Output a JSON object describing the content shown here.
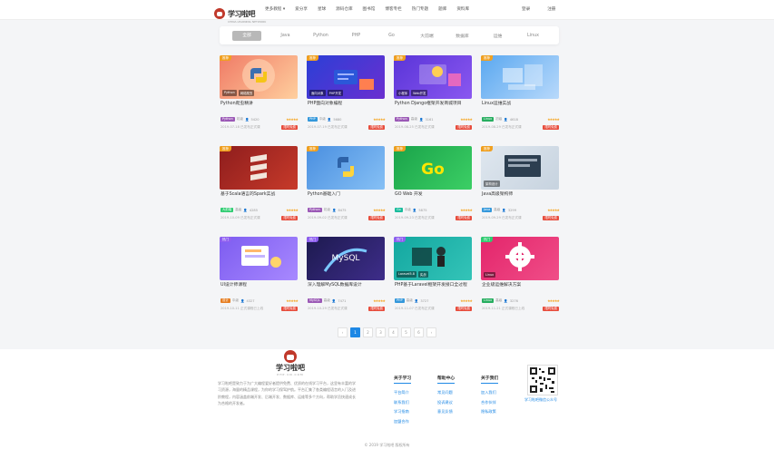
{
  "header": {
    "logo_text": "学习啦吧",
    "logo_sub": "CHINA LEARNING NETWORK",
    "nav": [
      "更多教程 ▾",
      "爱分享",
      "星球",
      "源码仓库",
      "图书馆",
      "博客专栏",
      "热门专题",
      "题库",
      "资料库"
    ],
    "auth": [
      "登录",
      "注册"
    ]
  },
  "filter": {
    "tabs": [
      "全部",
      "Java",
      "Python",
      "PHP",
      "Go",
      "大前端",
      "数据库",
      "运维",
      "Linux"
    ],
    "active_index": 0
  },
  "courses": [
    {
      "tag": "推荐",
      "tag_color": "orange",
      "badges": [
        "Python",
        "网络爬虫"
      ],
      "title": "Python爬虫精讲",
      "lang": "Python",
      "lang_color": "#9b59b6",
      "level": "初级",
      "views": "5420",
      "date": "2019-07-18 已发布正式课",
      "price": "限时免费",
      "bg": "#f07b66",
      "bg2": "#ffcf9e",
      "icon": "python"
    },
    {
      "tag": "推荐",
      "tag_color": "orange",
      "badges": [
        "面向对象",
        "PHP开发"
      ],
      "title": "PHP面向对象编程",
      "lang": "PHP",
      "lang_color": "#3498db",
      "level": "中级",
      "views": "5680",
      "date": "2019-07-19 已发布正式课",
      "price": "限时免费",
      "bg": "#2b3fd6",
      "bg2": "#6a2fd0",
      "icon": "php"
    },
    {
      "tag": "推荐",
      "tag_color": "orange",
      "badges": [
        "小程序",
        "Web开发"
      ],
      "title": "Python Django框架开发商城项目",
      "lang": "Python",
      "lang_color": "#9b59b6",
      "level": "高级",
      "views": "3161",
      "date": "2019-08-25 已发布正式课",
      "price": "限时免费",
      "bg": "#5a35d8",
      "bg2": "#8a57f0",
      "icon": "django"
    },
    {
      "tag": "推荐",
      "tag_color": "orange",
      "badges": [],
      "title": "Linux运维实战",
      "lang": "Linux",
      "lang_color": "#27ae60",
      "level": "初级",
      "views": "4618",
      "date": "2019-08-29 已发布正式课",
      "price": "限时免费",
      "bg": "#5aa8f0",
      "bg2": "#b8d9fb",
      "icon": "linux"
    },
    {
      "tag": "推荐",
      "tag_color": "orange",
      "badges": [],
      "title": "基于Scala语言的Spark实战",
      "lang": "大前端",
      "lang_color": "#2ecc71",
      "level": "高级",
      "views": "4285",
      "date": "2019-10-09 已发布正式课",
      "price": "限时免费",
      "bg": "#8e1d1d",
      "bg2": "#c73a2a",
      "icon": "scala"
    },
    {
      "tag": "推荐",
      "tag_color": "orange",
      "badges": [],
      "title": "Python基础入门",
      "lang": "Python",
      "lang_color": "#9b59b6",
      "level": "初级",
      "views": "8475",
      "date": "2019-09-02 已发布正式课",
      "price": "限时免费",
      "bg": "#4a8fe0",
      "bg2": "#86c0f5",
      "icon": "python2"
    },
    {
      "tag": "推荐",
      "tag_color": "orange",
      "badges": [],
      "title": "GO Web 开发",
      "lang": "Go",
      "lang_color": "#1abc9c",
      "level": "中级",
      "views": "5875",
      "date": "2019-09-23 已发布正式课",
      "price": "限时免费",
      "bg": "#1aa34a",
      "bg2": "#3ccf65",
      "icon": "go"
    },
    {
      "tag": "推荐",
      "tag_color": "orange",
      "badges": [
        "架构设计"
      ],
      "title": "Java高级架构师",
      "lang": "Java",
      "lang_color": "#3498db",
      "level": "高级",
      "views": "3299",
      "date": "2019-09-29 已发布正式课",
      "price": "限时免费",
      "bg": "#dfe7ef",
      "bg2": "#c7d3df",
      "icon": "java"
    },
    {
      "tag": "热门",
      "tag_color": "purple",
      "badges": [],
      "title": "UI设计师课程",
      "lang": "设计",
      "lang_color": "#e67e22",
      "level": "中级",
      "views": "4327",
      "date": "2019-10-11 正式课程已上线",
      "price": "限时免费",
      "bg": "#7d5cf0",
      "bg2": "#a889ff",
      "icon": "ui"
    },
    {
      "tag": "热门",
      "tag_color": "purple",
      "badges": [],
      "title": "深入理解MySQL数据库设计",
      "lang": "MySQL",
      "lang_color": "#9b59b6",
      "level": "高级",
      "views": "7471",
      "date": "2019-10-29 已发布正式课",
      "price": "限时免费",
      "bg": "#1d1a4f",
      "bg2": "#3e2d8a",
      "icon": "mysql"
    },
    {
      "tag": "热门",
      "tag_color": "purple",
      "badges": [
        "Laravel5.8",
        "实战"
      ],
      "title": "PHP基于Laravel框架开发接口全过程",
      "lang": "PHP",
      "lang_color": "#3498db",
      "level": "高级",
      "views": "3727",
      "date": "2019-11-07 已发布正式课",
      "price": "限时免费",
      "bg": "#13a7a0",
      "bg2": "#34c4b8",
      "icon": "laravel"
    },
    {
      "tag": "热门",
      "tag_color": "green",
      "badges": [
        "Linux"
      ],
      "title": "企业级运维解决方案",
      "lang": "Linux",
      "lang_color": "#27ae60",
      "level": "高级",
      "views": "3276",
      "date": "2019-11-21 正式课程已上线",
      "price": "限时免费",
      "bg": "#e3256b",
      "bg2": "#f04e88",
      "icon": "gear"
    }
  ],
  "pagination": {
    "prev": "‹",
    "pages": [
      "1",
      "2",
      "3",
      "4",
      "5",
      "6"
    ],
    "current": "1",
    "next": "›"
  },
  "footer": {
    "logo_text": "学习啦吧",
    "logo_sub": "PHP·CN·COM",
    "about": "学习啦吧是致力于为广大编程爱好者提供免费、优质的在线学习平台，这里有丰富的学习资源，海量的精品课程，为你的学习保驾护航。平台汇集了各类编程语言的入门及进阶教程，内容涵盖前端开发、后端开发、数据库、运维等多个方向，帮助学员快速成长为合格的开发者。",
    "columns": [
      {
        "title": "关于学习",
        "items": [
          "平台简介",
          "联系我们",
          "学习指南",
          "加盟合作"
        ]
      },
      {
        "title": "帮助中心",
        "items": [
          "常见问题",
          "投诉建议",
          "意见反馈"
        ]
      },
      {
        "title": "关于我们",
        "items": [
          "加入我们",
          "合作伙伴",
          "隐私政策"
        ]
      }
    ],
    "qr_caption": "学习啦吧微信公众号",
    "copyright": "© 2019 学习啦吧 版权所有"
  }
}
